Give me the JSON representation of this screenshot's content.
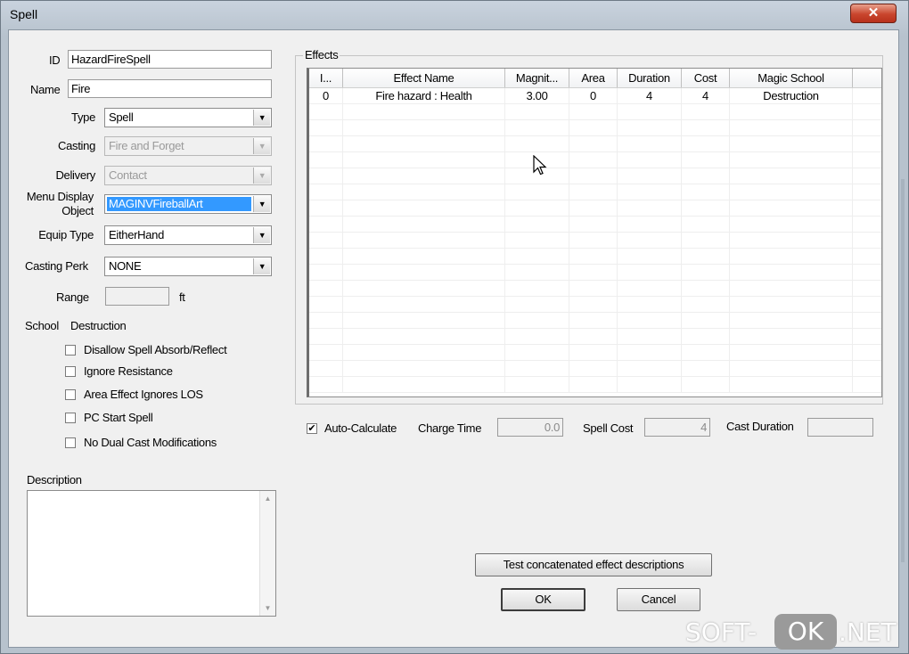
{
  "window": {
    "title": "Spell",
    "close_glyph": "✕"
  },
  "form": {
    "id_label": "ID",
    "id_value": "HazardFireSpell",
    "name_label": "Name",
    "name_value": "Fire",
    "type_label": "Type",
    "type_value": "Spell",
    "casting_label": "Casting",
    "casting_value": "Fire and Forget",
    "delivery_label": "Delivery",
    "delivery_value": "Contact",
    "menu_display_label_1": "Menu Display",
    "menu_display_label_2": "Object",
    "menu_display_value": "MAGINVFireballArt",
    "equip_type_label": "Equip Type",
    "equip_type_value": "EitherHand",
    "casting_perk_label": "Casting Perk",
    "casting_perk_value": "NONE",
    "range_label": "Range",
    "range_value": "",
    "range_unit": "ft",
    "school_label": "School",
    "school_value": "Destruction"
  },
  "checkboxes": [
    {
      "label": "Disallow Spell Absorb/Reflect",
      "checked": false
    },
    {
      "label": "Ignore Resistance",
      "checked": false
    },
    {
      "label": "Area Effect Ignores LOS",
      "checked": false
    },
    {
      "label": "PC Start Spell",
      "checked": false
    },
    {
      "label": "No Dual Cast Modifications",
      "checked": false
    }
  ],
  "description": {
    "label": "Description",
    "value": ""
  },
  "effects": {
    "group_label": "Effects",
    "columns": [
      "I...",
      "Effect Name",
      "Magnit...",
      "Area",
      "Duration",
      "Cost",
      "Magic School"
    ],
    "rows": [
      [
        "0",
        "Fire hazard : Health",
        "3.00",
        "0",
        "4",
        "4",
        "Destruction"
      ]
    ]
  },
  "calc": {
    "auto_calculate_label": "Auto-Calculate",
    "auto_calculate_checked": true,
    "check_glyph": "✔",
    "charge_time_label": "Charge Time",
    "charge_time_value": "0.0",
    "spell_cost_label": "Spell Cost",
    "spell_cost_value": "4",
    "cast_duration_label": "Cast Duration",
    "cast_duration_value": ""
  },
  "buttons": {
    "test_label": "Test concatenated effect descriptions",
    "ok_label": "OK",
    "cancel_label": "Cancel"
  },
  "watermark": {
    "part1": "SOFT-",
    "part2": "OK",
    "part3": ".NET"
  },
  "icons": {
    "dropdown": "▼",
    "scroll_up": "▲",
    "scroll_down": "▼"
  }
}
